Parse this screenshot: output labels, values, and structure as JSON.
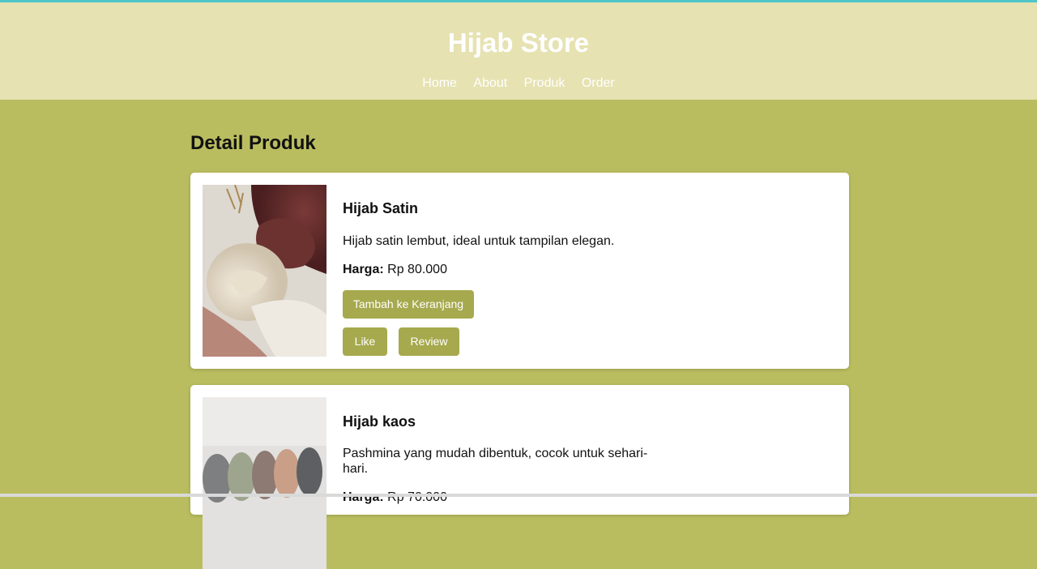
{
  "site": {
    "title": "Hijab Store"
  },
  "nav": [
    "Home",
    "About",
    "Produk",
    "Order"
  ],
  "section_title": "Detail Produk",
  "products": [
    {
      "name": "Hijab Satin",
      "description": "Hijab satin lembut, ideal untuk tampilan elegan.",
      "price_label": "Harga:",
      "price": "Rp 80.000",
      "cart_button": "Tambah ke Keranjang",
      "like_button": "Like",
      "review_button": "Review"
    },
    {
      "name": "Hijab kaos",
      "description": "Pashmina yang mudah dibentuk, cocok untuk sehari-hari.",
      "price_label": "Harga:",
      "price": "Rp 70.000"
    }
  ],
  "colors": {
    "header_bg": "#e6e2b2",
    "page_bg": "#b9bd5f",
    "button_bg": "#a6a94d"
  }
}
